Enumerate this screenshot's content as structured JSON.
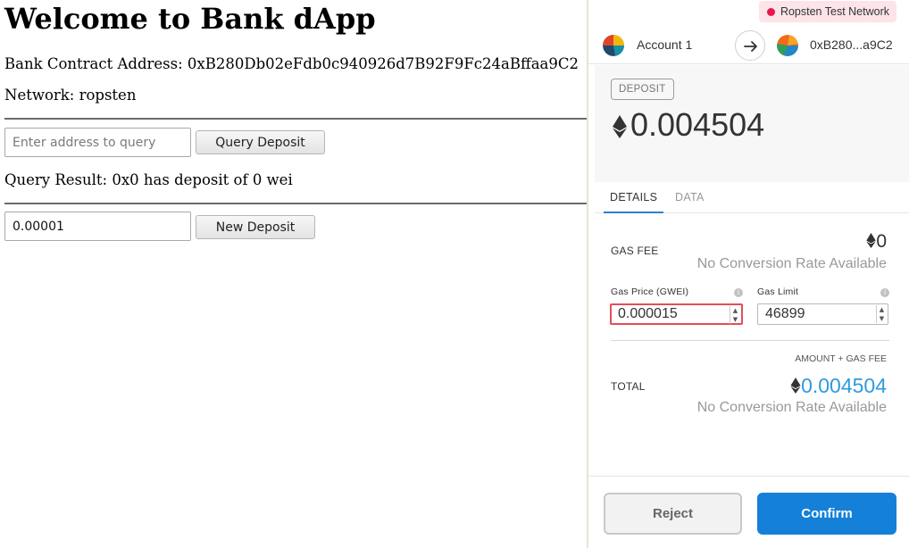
{
  "page": {
    "title": "Welcome to Bank dApp",
    "contract_address_line": "Bank Contract Address: 0xB280Db02eFdb0c940926d7B92F9Fc24aBffaa9C2",
    "network_line": "Network: ropsten",
    "query": {
      "placeholder": "Enter address to query",
      "button_label": "Query Deposit",
      "result_line": "Query Result: 0x0 has deposit of 0 wei"
    },
    "deposit": {
      "input_value": "0.00001",
      "button_label": "New Deposit"
    }
  },
  "metamask": {
    "network_label": "Ropsten Test Network",
    "network_color": "#e91550",
    "from_account": "Account 1",
    "to_account": "0xB280...a9C2",
    "action_tag": "DEPOSIT",
    "amount": "0.004504",
    "tabs": [
      {
        "label": "DETAILS",
        "active": true
      },
      {
        "label": "DATA",
        "active": false
      }
    ],
    "gas_fee": {
      "label": "GAS FEE",
      "value": "0",
      "conversion": "No Conversion Rate Available"
    },
    "gas_price": {
      "label": "Gas Price (GWEI)",
      "value": "0.000015"
    },
    "gas_limit": {
      "label": "Gas Limit",
      "value": "46899"
    },
    "total": {
      "caption": "AMOUNT + GAS FEE",
      "label": "TOTAL",
      "value": "0.004504",
      "conversion": "No Conversion Rate Available",
      "color": "#2f9ae0"
    },
    "buttons": {
      "reject": "Reject",
      "confirm": "Confirm"
    },
    "icons": {
      "arrow": "arrow-right-icon",
      "eth": "ethereum-icon",
      "info": "info-icon"
    }
  }
}
